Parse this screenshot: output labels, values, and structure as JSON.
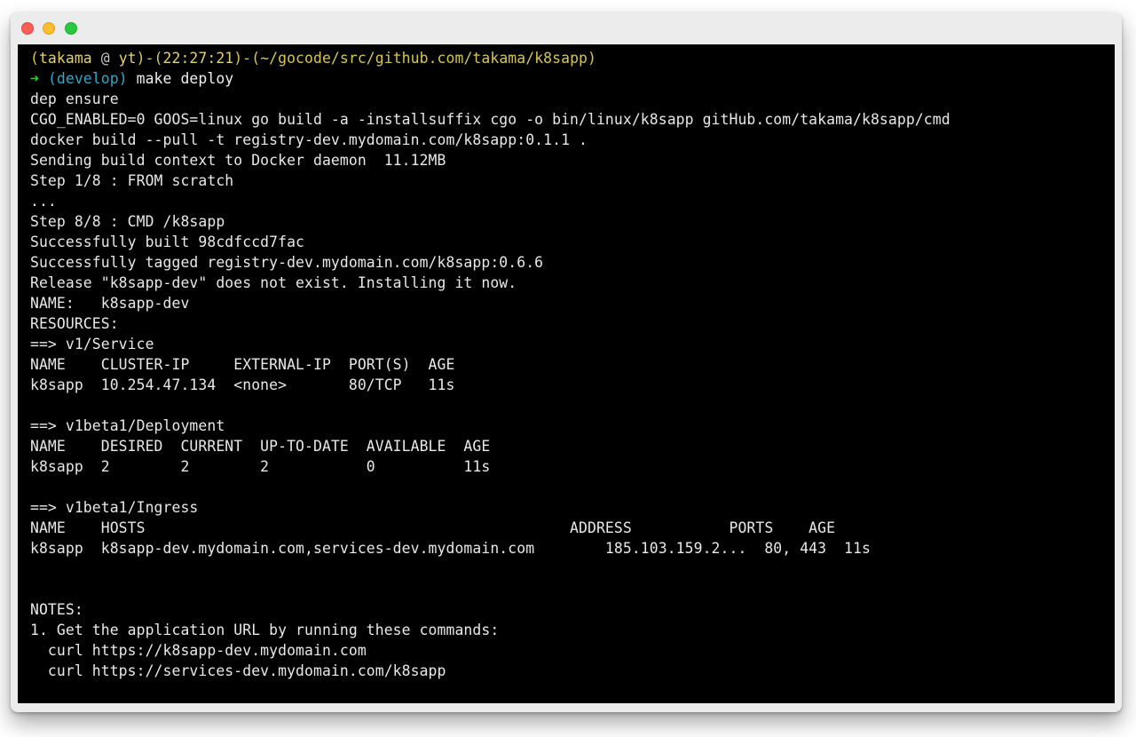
{
  "window": {
    "controls": {
      "close_color": "#fe5f57",
      "minimize_color": "#febc2e",
      "zoom_color": "#28c840"
    }
  },
  "terminal": {
    "background": "#000000",
    "prompt": {
      "open_paren": "(",
      "user": "takama",
      "at": " @ ",
      "host": "yt",
      "close_paren_dash": ")-(",
      "time": "22:27:21",
      "close_paren_dash2": ")-(",
      "path": "~/gocode/src/github.com/takama/k8sapp",
      "close_paren": ")",
      "arrow": "➜",
      "branch": "(develop)",
      "command": "make deploy"
    },
    "output": [
      "dep ensure",
      "CGO_ENABLED=0 GOOS=linux go build -a -installsuffix cgo -o bin/linux/k8sapp gitHub.com/takama/k8sapp/cmd",
      "docker build --pull -t registry-dev.mydomain.com/k8sapp:0.1.1 .",
      "Sending build context to Docker daemon  11.12MB",
      "Step 1/8 : FROM scratch",
      "...",
      "Step 8/8 : CMD /k8sapp",
      "Successfully built 98cdfccd7fac",
      "Successfully tagged registry-dev.mydomain.com/k8sapp:0.6.6",
      "Release \"k8sapp-dev\" does not exist. Installing it now.",
      "NAME:   k8sapp-dev",
      "RESOURCES:",
      "==> v1/Service",
      "NAME    CLUSTER-IP     EXTERNAL-IP  PORT(S)  AGE",
      "k8sapp  10.254.47.134  <none>       80/TCP   11s",
      "",
      "==> v1beta1/Deployment",
      "NAME    DESIRED  CURRENT  UP-TO-DATE  AVAILABLE  AGE",
      "k8sapp  2        2        2           0          11s",
      "",
      "==> v1beta1/Ingress",
      "NAME    HOSTS                                                ADDRESS           PORTS    AGE",
      "k8sapp  k8sapp-dev.mydomain.com,services-dev.mydomain.com        185.103.159.2...  80, 443  11s",
      "",
      "",
      "NOTES:",
      "1. Get the application URL by running these commands:",
      "  curl https://k8sapp-dev.mydomain.com",
      "  curl https://services-dev.mydomain.com/k8sapp"
    ]
  }
}
